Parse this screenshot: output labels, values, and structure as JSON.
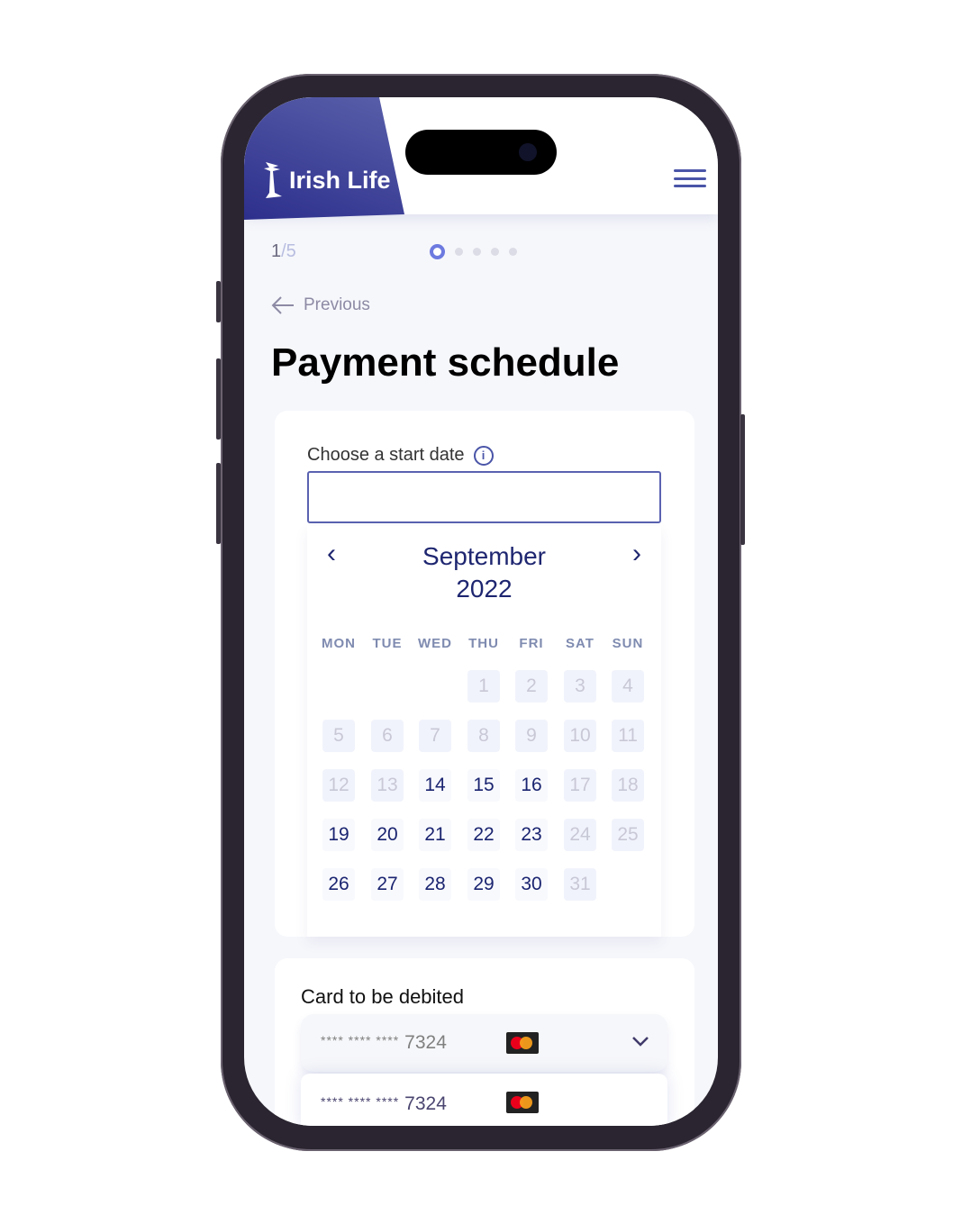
{
  "header": {
    "logo_text": "Irish Life",
    "menu_icon": "hamburger-icon"
  },
  "progress": {
    "current": "1",
    "total": "/5",
    "steps": 5,
    "active_step": 1
  },
  "nav": {
    "previous_label": "Previous"
  },
  "page_title": "Payment schedule",
  "date_picker": {
    "label": "Choose a start date",
    "input_value": "",
    "month": "September",
    "year": "2022",
    "weekdays": [
      "MON",
      "TUE",
      "WED",
      "THU",
      "FRI",
      "SAT",
      "SUN"
    ],
    "first_weekday_index": 3,
    "days_in_month": 30,
    "last_day": 31,
    "enabled_days": [
      14,
      15,
      16,
      19,
      20,
      21,
      22,
      23,
      26,
      27,
      28,
      29,
      30
    ]
  },
  "card": {
    "label": "Card to be debited",
    "selected": {
      "mask": "**** **** ****",
      "last4": "7324",
      "brand": "mastercard"
    },
    "options": [
      {
        "mask": "**** **** ****",
        "last4": "7324",
        "brand": "mastercard"
      }
    ]
  },
  "colors": {
    "brand": "#2d2f8c",
    "accent": "#6d7ae0",
    "day_enabled": "#1a2470",
    "day_disabled": "#c8c8d6"
  }
}
